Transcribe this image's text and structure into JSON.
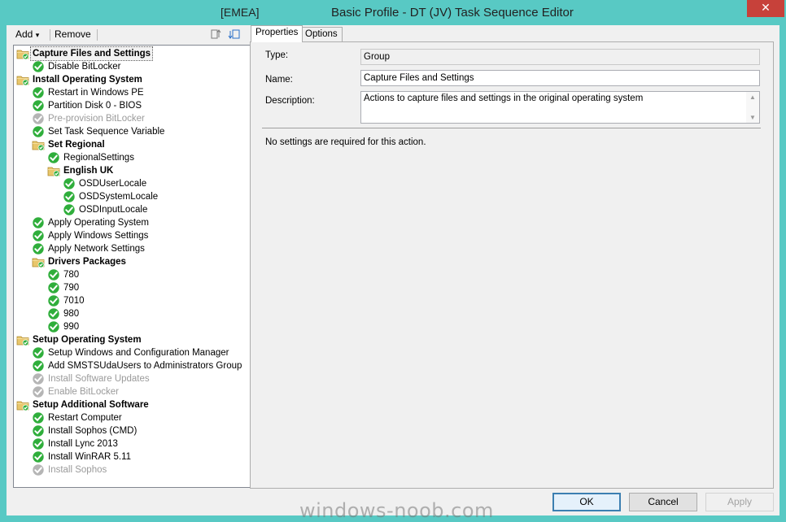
{
  "window": {
    "title_prefix": "[EMEA]",
    "title": "Basic Profile - DT (JV) Task Sequence Editor",
    "close_glyph": "✕"
  },
  "toolbar": {
    "add_label": "Add",
    "add_arrow": "▾",
    "remove_label": "Remove"
  },
  "tree": [
    {
      "label": "Capture Files and Settings",
      "kind": "group",
      "level": 0,
      "selected": true
    },
    {
      "label": "Disable BitLocker",
      "kind": "step",
      "level": 1,
      "status": "ok"
    },
    {
      "label": "Install Operating System",
      "kind": "group",
      "level": 0
    },
    {
      "label": "Restart in Windows PE",
      "kind": "step",
      "level": 1,
      "status": "ok"
    },
    {
      "label": "Partition Disk 0 - BIOS",
      "kind": "step",
      "level": 1,
      "status": "ok"
    },
    {
      "label": "Pre-provision BitLocker",
      "kind": "step",
      "level": 1,
      "status": "disabled"
    },
    {
      "label": "Set Task Sequence Variable",
      "kind": "step",
      "level": 1,
      "status": "ok"
    },
    {
      "label": "Set Regional",
      "kind": "group",
      "level": 1
    },
    {
      "label": "RegionalSettings",
      "kind": "step",
      "level": 2,
      "status": "ok"
    },
    {
      "label": "English UK",
      "kind": "group",
      "level": 2
    },
    {
      "label": "OSDUserLocale",
      "kind": "step",
      "level": 3,
      "status": "ok"
    },
    {
      "label": "OSDSystemLocale",
      "kind": "step",
      "level": 3,
      "status": "ok"
    },
    {
      "label": "OSDInputLocale",
      "kind": "step",
      "level": 3,
      "status": "ok"
    },
    {
      "label": "Apply Operating System",
      "kind": "step",
      "level": 1,
      "status": "ok"
    },
    {
      "label": "Apply Windows Settings",
      "kind": "step",
      "level": 1,
      "status": "ok"
    },
    {
      "label": "Apply Network Settings",
      "kind": "step",
      "level": 1,
      "status": "ok"
    },
    {
      "label": "Drivers Packages",
      "kind": "group",
      "level": 1
    },
    {
      "label": "780",
      "kind": "step",
      "level": 2,
      "status": "ok"
    },
    {
      "label": "790",
      "kind": "step",
      "level": 2,
      "status": "ok"
    },
    {
      "label": "7010",
      "kind": "step",
      "level": 2,
      "status": "ok"
    },
    {
      "label": "980",
      "kind": "step",
      "level": 2,
      "status": "ok"
    },
    {
      "label": "990",
      "kind": "step",
      "level": 2,
      "status": "ok"
    },
    {
      "label": "Setup Operating System",
      "kind": "group",
      "level": 0
    },
    {
      "label": "Setup Windows and Configuration Manager",
      "kind": "step",
      "level": 1,
      "status": "ok"
    },
    {
      "label": "Add SMSTSUdaUsers to Administrators Group",
      "kind": "step",
      "level": 1,
      "status": "ok"
    },
    {
      "label": "Install Software Updates",
      "kind": "step",
      "level": 1,
      "status": "disabled"
    },
    {
      "label": "Enable BitLocker",
      "kind": "step",
      "level": 1,
      "status": "disabled"
    },
    {
      "label": "Setup Additional Software",
      "kind": "group",
      "level": 0
    },
    {
      "label": "Restart Computer",
      "kind": "step",
      "level": 1,
      "status": "ok"
    },
    {
      "label": "Install Sophos (CMD)",
      "kind": "step",
      "level": 1,
      "status": "ok"
    },
    {
      "label": "Install Lync 2013",
      "kind": "step",
      "level": 1,
      "status": "ok"
    },
    {
      "label": "Install WinRAR 5.11",
      "kind": "step",
      "level": 1,
      "status": "ok"
    },
    {
      "label": "Install Sophos",
      "kind": "step",
      "level": 1,
      "status": "disabled"
    }
  ],
  "tabs": {
    "properties": "Properties",
    "options": "Options"
  },
  "properties": {
    "type_label": "Type:",
    "type_value": "Group",
    "name_label": "Name:",
    "name_value": "Capture Files and Settings",
    "description_label": "Description:",
    "description_value": "Actions to capture files and settings in the original operating system",
    "note": "No settings are required  for this action."
  },
  "buttons": {
    "ok": "OK",
    "cancel": "Cancel",
    "apply": "Apply"
  },
  "watermark": "windows-noob.com",
  "colors": {
    "titlebar": "#58c9c4",
    "close": "#c7413a",
    "ok_green": "#2fae3b",
    "disabled_grey": "#b5b5b5",
    "folder": "#e8c66b"
  }
}
